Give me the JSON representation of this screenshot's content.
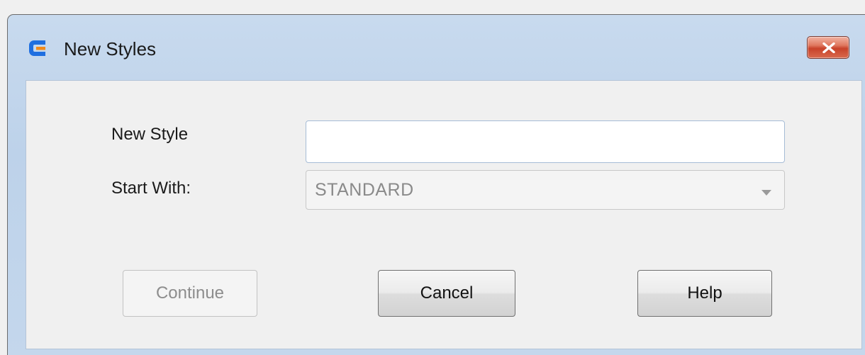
{
  "window": {
    "title": "New Styles",
    "close_icon": "close-x-icon",
    "app_icon": "app-logo-icon"
  },
  "form": {
    "new_style_label": "New Style",
    "new_style_value": "",
    "start_with_label": "Start With:",
    "start_with_selected": "STANDARD"
  },
  "buttons": {
    "continue_label": "Continue",
    "continue_enabled": false,
    "cancel_label": "Cancel",
    "help_label": "Help"
  },
  "colors": {
    "titlebar": "#c4d7ec",
    "close_button": "#d45a3e",
    "app_icon_blue": "#1f6fe0",
    "app_icon_orange": "#f08a1c"
  }
}
